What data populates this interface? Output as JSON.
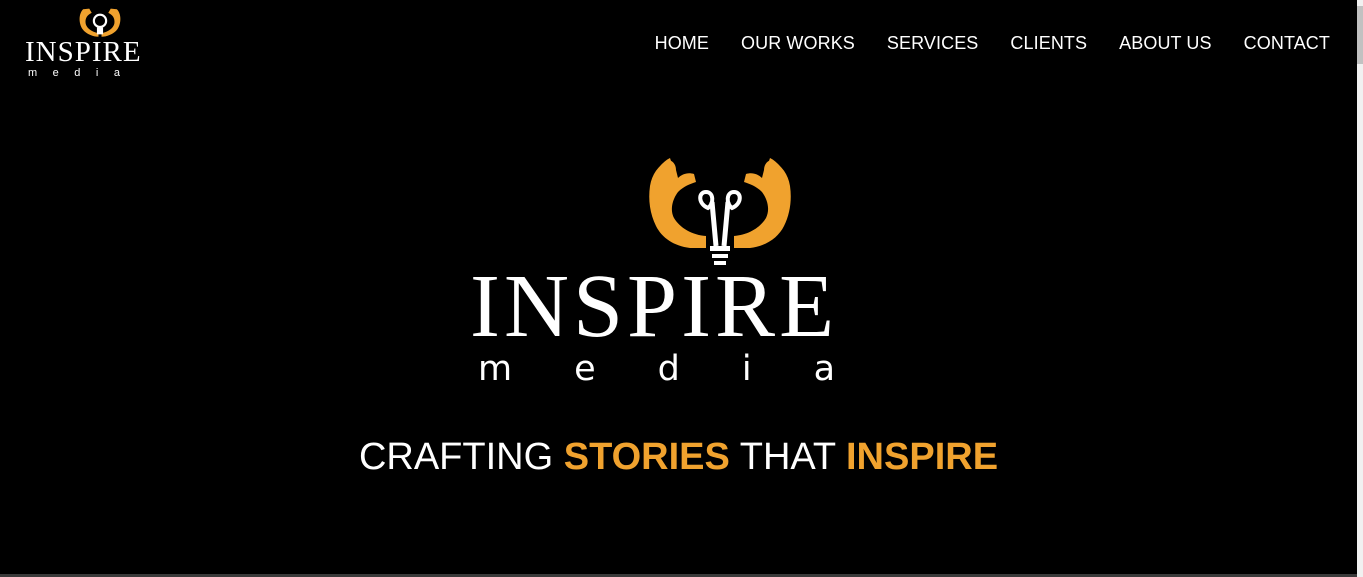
{
  "brand": {
    "name": "INSPIRE",
    "sub": "media",
    "accent_color": "#f0a22e",
    "icon": "hands-lightbulb-logo"
  },
  "nav": {
    "items": [
      {
        "label": "HOME"
      },
      {
        "label": "OUR WORKS"
      },
      {
        "label": "SERVICES"
      },
      {
        "label": "CLIENTS"
      },
      {
        "label": "ABOUT US"
      },
      {
        "label": "CONTACT"
      }
    ]
  },
  "hero": {
    "tagline_part1": "CRAFTING ",
    "tagline_accent1": "STORIES",
    "tagline_part2": " THAT ",
    "tagline_accent2": "INSPIRE"
  }
}
